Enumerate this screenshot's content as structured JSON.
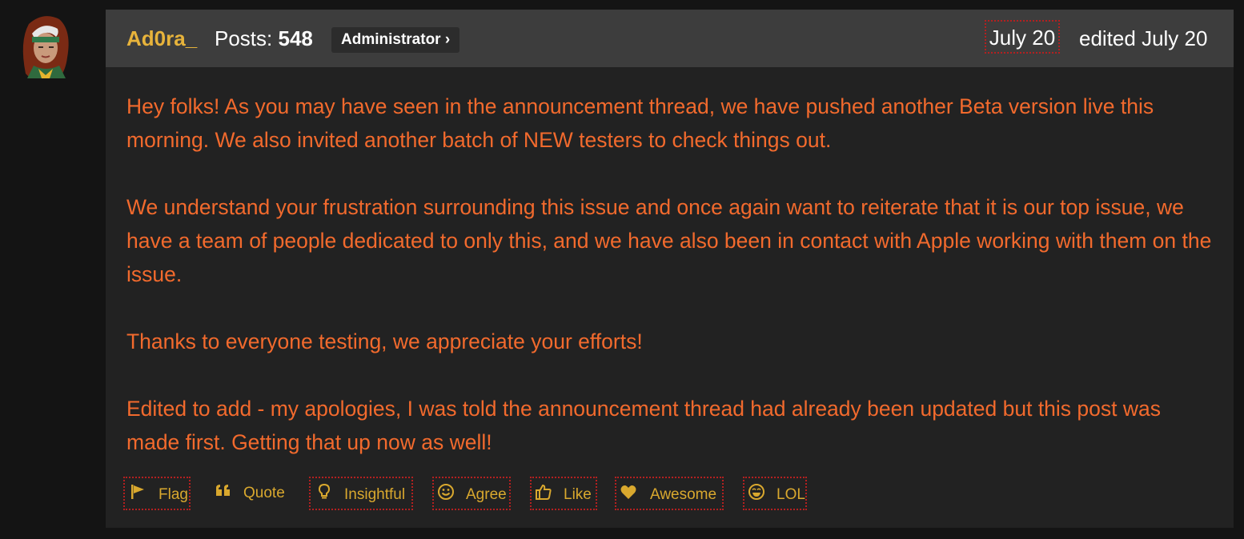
{
  "user": {
    "name": "Ad0ra_",
    "posts_label": "Posts:",
    "posts_count": "548",
    "role": "Administrator ›",
    "avatar_icon": "character-avatar"
  },
  "post": {
    "date": "July 20",
    "edited": "edited July 20",
    "paragraphs": [
      "Hey folks! As you may have seen in the announcement thread, we have pushed another Beta version live this morning. We also invited another batch of NEW testers to check things out.",
      "We understand your frustration surrounding this issue and once again want to reiterate that it is our top issue, we have a team of people dedicated to only this, and we have also been in contact with Apple working with them on the issue.",
      "Thanks to everyone testing, we appreciate your efforts!",
      "Edited to add - my apologies, I was told the announcement thread had already been updated but this post was made first. Getting that up now as well!"
    ]
  },
  "reactions": [
    {
      "label": "Flag",
      "icon": "flag-icon"
    },
    {
      "label": "Quote",
      "icon": "quote-icon"
    },
    {
      "label": "Insightful",
      "icon": "lightbulb-icon"
    },
    {
      "label": "Agree",
      "icon": "smile-icon"
    },
    {
      "label": "Like",
      "icon": "thumbs-up-icon"
    },
    {
      "label": "Awesome",
      "icon": "heart-icon"
    },
    {
      "label": "LOL",
      "icon": "laugh-icon"
    }
  ],
  "colors": {
    "background": "#141414",
    "post_bg": "#222222",
    "header_bg": "#3d3d3d",
    "username": "#e7b33b",
    "body_text": "#f26a2d",
    "reaction_text": "#d9a82e",
    "focus_outline": "#b42020"
  }
}
